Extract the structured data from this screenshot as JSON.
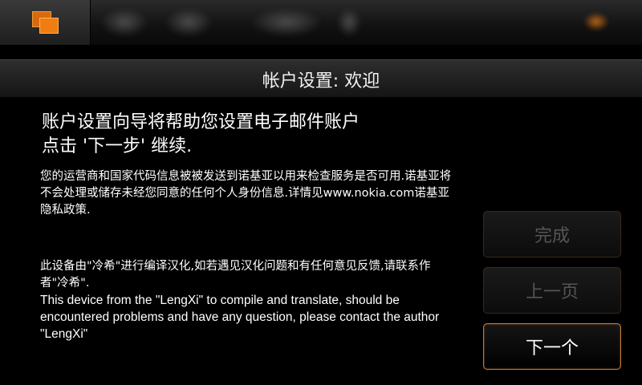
{
  "title": "帐户设置: 欢迎",
  "content": {
    "heading_line1": "账户设置向导将帮助您设置电子邮件账户",
    "heading_line2": "点击 '下一步' 继续.",
    "info": "您的运营商和国家代码信息被被发送到诺基亚以用来检查服务是否可用.诺基亚将不会处理或储存未经您同意的任何个人身份信息.详情见www.nokia.com诺基亚隐私政策.",
    "credit_cn": "此设备由\"冷希\"进行编译汉化,如若遇见汉化问题和有任何意见反馈,请联系作者\"冷希\".",
    "credit_en": "This device from the \"LengXi\" to compile and translate, should be encountered problems and have any question, please contact the author \"LengXi\""
  },
  "buttons": {
    "finish": "完成",
    "previous": "上一页",
    "next": "下一个"
  },
  "colors": {
    "accent": "#f07d12",
    "active_border": "#c27a3a"
  },
  "icons": {
    "task_switcher": "task-switcher-icon"
  }
}
